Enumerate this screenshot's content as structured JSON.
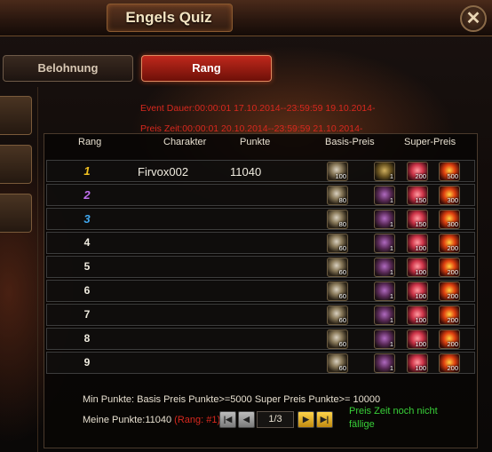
{
  "window": {
    "title": "Engels Quiz",
    "close_symbol": "✕"
  },
  "tabs": [
    {
      "label": "Belohnung",
      "active": false
    },
    {
      "label": "Rang",
      "active": true
    }
  ],
  "event": {
    "dauer": "Event Dauer:00:00:01 17.10.2014--23:59:59 19.10.2014-",
    "preis_zeit": "Preis Zeit:00:00:01 20.10.2014--23:59:59 21.10.2014-"
  },
  "table": {
    "headers": {
      "rang": "Rang",
      "charakter": "Charakter",
      "punkte": "Punkte",
      "basis": "Basis-Preis",
      "super": "Super-Preis"
    },
    "rows": [
      {
        "rank": "1",
        "rank_color": "#f0c020",
        "charakter": "Firvox002",
        "punkte": "11040",
        "basis": [
          {
            "icon": "orb-icon",
            "qty": "100"
          }
        ],
        "super": [
          {
            "icon": "helm-icon",
            "qty": "1"
          },
          {
            "icon": "flower-icon",
            "qty": "200"
          },
          {
            "icon": "gem-icon",
            "qty": "500"
          }
        ]
      },
      {
        "rank": "2",
        "rank_color": "#c070f0",
        "charakter": "",
        "punkte": "",
        "basis": [
          {
            "icon": "orb-icon",
            "qty": "80"
          }
        ],
        "super": [
          {
            "icon": "pouch-icon",
            "qty": "1"
          },
          {
            "icon": "flower-icon",
            "qty": "150"
          },
          {
            "icon": "gem-icon",
            "qty": "300"
          }
        ]
      },
      {
        "rank": "3",
        "rank_color": "#40a8f0",
        "charakter": "",
        "punkte": "",
        "basis": [
          {
            "icon": "orb-icon",
            "qty": "80"
          }
        ],
        "super": [
          {
            "icon": "pouch-icon",
            "qty": "1"
          },
          {
            "icon": "flower-icon",
            "qty": "150"
          },
          {
            "icon": "gem-icon",
            "qty": "300"
          }
        ]
      },
      {
        "rank": "4",
        "rank_color": "",
        "charakter": "",
        "punkte": "",
        "basis": [
          {
            "icon": "orb-icon",
            "qty": "60"
          }
        ],
        "super": [
          {
            "icon": "pouch-icon",
            "qty": "1"
          },
          {
            "icon": "flower-icon",
            "qty": "100"
          },
          {
            "icon": "gem-icon",
            "qty": "200"
          }
        ]
      },
      {
        "rank": "5",
        "rank_color": "",
        "charakter": "",
        "punkte": "",
        "basis": [
          {
            "icon": "orb-icon",
            "qty": "60"
          }
        ],
        "super": [
          {
            "icon": "pouch-icon",
            "qty": "1"
          },
          {
            "icon": "flower-icon",
            "qty": "100"
          },
          {
            "icon": "gem-icon",
            "qty": "200"
          }
        ]
      },
      {
        "rank": "6",
        "rank_color": "",
        "charakter": "",
        "punkte": "",
        "basis": [
          {
            "icon": "orb-icon",
            "qty": "60"
          }
        ],
        "super": [
          {
            "icon": "pouch-icon",
            "qty": "1"
          },
          {
            "icon": "flower-icon",
            "qty": "100"
          },
          {
            "icon": "gem-icon",
            "qty": "200"
          }
        ]
      },
      {
        "rank": "7",
        "rank_color": "",
        "charakter": "",
        "punkte": "",
        "basis": [
          {
            "icon": "orb-icon",
            "qty": "60"
          }
        ],
        "super": [
          {
            "icon": "pouch-icon",
            "qty": "1"
          },
          {
            "icon": "flower-icon",
            "qty": "100"
          },
          {
            "icon": "gem-icon",
            "qty": "200"
          }
        ]
      },
      {
        "rank": "8",
        "rank_color": "",
        "charakter": "",
        "punkte": "",
        "basis": [
          {
            "icon": "orb-icon",
            "qty": "60"
          }
        ],
        "super": [
          {
            "icon": "pouch-icon",
            "qty": "1"
          },
          {
            "icon": "flower-icon",
            "qty": "100"
          },
          {
            "icon": "gem-icon",
            "qty": "200"
          }
        ]
      },
      {
        "rank": "9",
        "rank_color": "",
        "charakter": "",
        "punkte": "",
        "basis": [
          {
            "icon": "orb-icon",
            "qty": "60"
          }
        ],
        "super": [
          {
            "icon": "pouch-icon",
            "qty": "1"
          },
          {
            "icon": "flower-icon",
            "qty": "100"
          },
          {
            "icon": "gem-icon",
            "qty": "200"
          }
        ]
      }
    ]
  },
  "footer": {
    "min_punkte": "Min Punkte: Basis Preis Punkte>=5000 Super Preis Punkte>= 10000",
    "meine_punkte": "Meine Punkte:11040",
    "rang": "(Rang: #1)",
    "page": "1/3",
    "status": "Preis Zeit noch nicht fällige"
  },
  "colors": {
    "accent_red": "#d8281e",
    "status_green": "#38d038"
  }
}
